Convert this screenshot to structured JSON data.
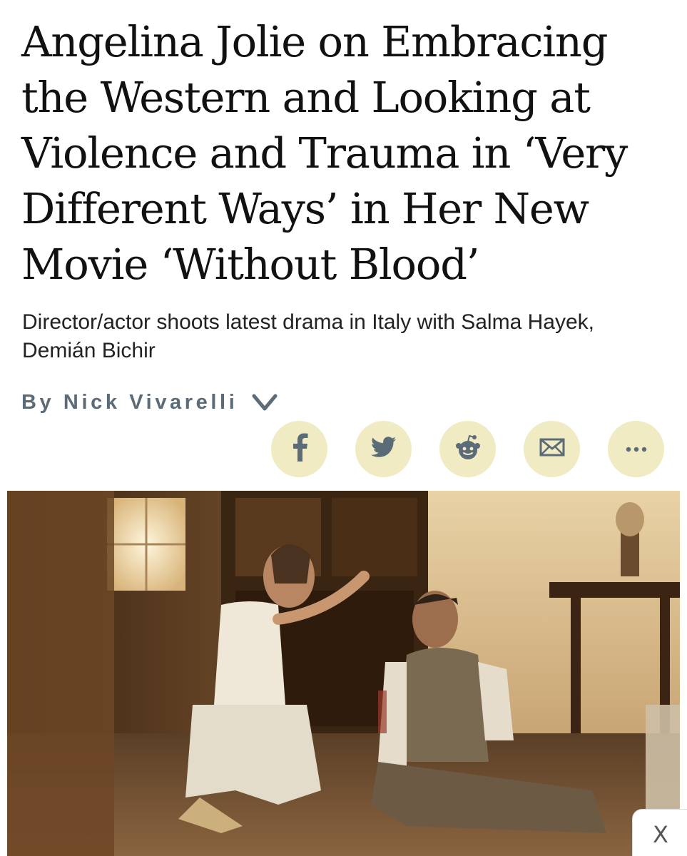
{
  "article": {
    "headline": "Angelina Jolie on Embracing the Western and Looking at Violence and Trauma in ‘Very Different Ways’ in Her New Movie ‘Without Blood’",
    "dek": "Director/actor shoots latest drama in Italy with Salma Hayek, Demián Bichir",
    "byline": "By Nick Vivarelli",
    "byline_icon": "chevron-down-icon"
  },
  "share": {
    "background_color": "#f0ebc2",
    "icon_color": "#5c6b78",
    "buttons": [
      {
        "name": "facebook",
        "icon": "facebook-icon"
      },
      {
        "name": "twitter",
        "icon": "twitter-icon"
      },
      {
        "name": "reddit",
        "icon": "reddit-icon"
      },
      {
        "name": "email",
        "icon": "email-icon"
      },
      {
        "name": "more",
        "icon": "more-icon"
      }
    ]
  },
  "photo": {
    "subject": "film-set-photo"
  },
  "ad": {
    "close_label": "X"
  }
}
